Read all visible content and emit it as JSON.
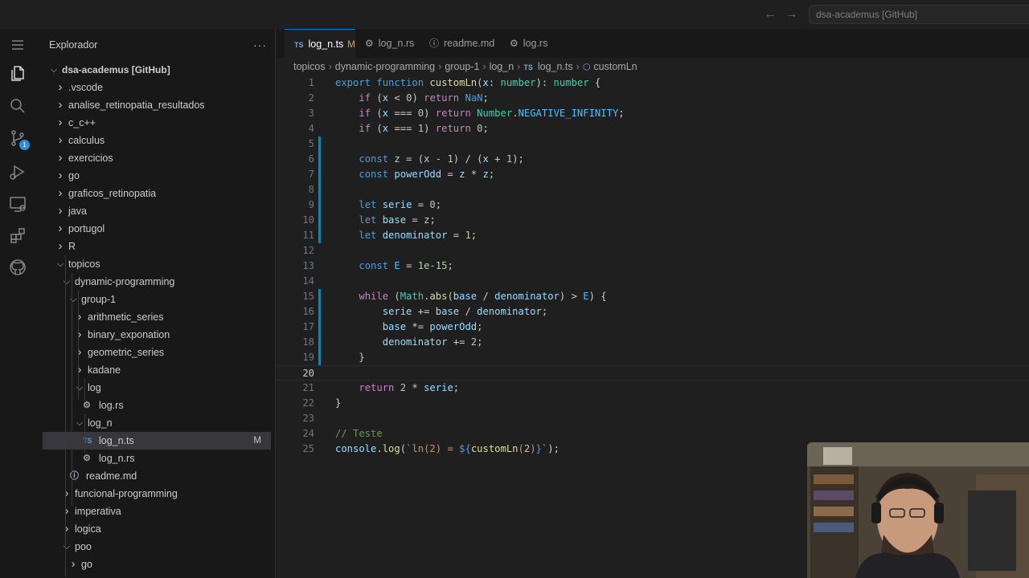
{
  "titlebar": {
    "back_icon": "arrow-left-icon",
    "forward_icon": "arrow-right-icon",
    "command_center": "dsa-academus [GitHub]"
  },
  "activity_bar": {
    "items": [
      "menu-icon",
      "files-icon",
      "search-icon",
      "source-control-icon",
      "run-debug-icon",
      "remote-explorer-icon",
      "extensions-icon",
      "github-icon"
    ],
    "source_control_badge": "1"
  },
  "sidebar": {
    "title": "Explorador",
    "more": "···",
    "root": "dsa-academus [GitHub]",
    "items": [
      {
        "label": ".vscode",
        "kind": "folder",
        "expanded": false
      },
      {
        "label": "analise_retinopatia_resultados",
        "kind": "folder",
        "expanded": false
      },
      {
        "label": "c_c++",
        "kind": "folder",
        "expanded": false
      },
      {
        "label": "calculus",
        "kind": "folder",
        "expanded": false
      },
      {
        "label": "exercicios",
        "kind": "folder",
        "expanded": false
      },
      {
        "label": "go",
        "kind": "folder",
        "expanded": false
      },
      {
        "label": "graficos_retinopatia",
        "kind": "folder",
        "expanded": false
      },
      {
        "label": "java",
        "kind": "folder",
        "expanded": false
      },
      {
        "label": "portugol",
        "kind": "folder",
        "expanded": false
      },
      {
        "label": "R",
        "kind": "folder",
        "expanded": false
      },
      {
        "label": "topicos",
        "kind": "folder",
        "expanded": true
      },
      {
        "label": "dynamic-programming",
        "kind": "folder",
        "expanded": true
      },
      {
        "label": "group-1",
        "kind": "folder",
        "expanded": true
      },
      {
        "label": "arithmetic_series",
        "kind": "folder",
        "expanded": false
      },
      {
        "label": "binary_exponation",
        "kind": "folder",
        "expanded": false
      },
      {
        "label": "geometric_series",
        "kind": "folder",
        "expanded": false
      },
      {
        "label": "kadane",
        "kind": "folder",
        "expanded": false
      },
      {
        "label": "log",
        "kind": "folder",
        "expanded": true
      },
      {
        "label": "log.rs",
        "kind": "rust-file"
      },
      {
        "label": "log_n",
        "kind": "folder",
        "expanded": true
      },
      {
        "label": "log_n.ts",
        "kind": "ts-file",
        "icon_text": "TS",
        "status": "M"
      },
      {
        "label": "log_n.rs",
        "kind": "rust-file"
      },
      {
        "label": "readme.md",
        "kind": "info-file"
      },
      {
        "label": "funcional-programming",
        "kind": "folder",
        "expanded": false
      },
      {
        "label": "imperativa",
        "kind": "folder",
        "expanded": false
      },
      {
        "label": "logica",
        "kind": "folder",
        "expanded": false
      },
      {
        "label": "poo",
        "kind": "folder",
        "expanded": true
      },
      {
        "label": "go",
        "kind": "folder",
        "expanded": false
      }
    ]
  },
  "tabs": [
    {
      "label": "log_n.ts",
      "icon_text": "TS",
      "modified": "M",
      "active": true
    },
    {
      "label": "log_n.rs",
      "icon": "rust-icon"
    },
    {
      "label": "readme.md",
      "icon": "info-icon"
    },
    {
      "label": "log.rs",
      "icon": "rust-icon"
    }
  ],
  "breadcrumb": {
    "parts": [
      "topicos",
      "dynamic-programming",
      "group-1",
      "log_n"
    ],
    "file": "log_n.ts",
    "file_icon_text": "TS",
    "symbol": "customLn"
  },
  "editor": {
    "language": "typescript",
    "current_line": 20,
    "lines": [
      "export function customLn(x: number): number {",
      "    if (x < 0) return NaN;",
      "    if (x === 0) return Number.NEGATIVE_INFINITY;",
      "    if (x === 1) return 0;",
      "",
      "    const z = (x - 1) / (x + 1);",
      "    const powerOdd = z * z;",
      "",
      "    let serie = 0;",
      "    let base = z;",
      "    let denominator = 1;",
      "",
      "    const E = 1e-15;",
      "",
      "    while (Math.abs(base / denominator) > E) {",
      "        serie += base / denominator;",
      "        base *= powerOdd;",
      "        denominator += 2;",
      "    }",
      "",
      "    return 2 * serie;",
      "}",
      "",
      "// Teste",
      "console.log(`ln(2) = ${customLn(2)}`);"
    ]
  },
  "webcam": {
    "content": "webcam-overlay"
  },
  "colors": {
    "keyword": "#569cd6",
    "control": "#c586c0",
    "function": "#dcdcaa",
    "variable": "#9cdcfe",
    "type": "#4ec9b0",
    "number": "#b5cea8",
    "comment": "#6a9955",
    "string": "#ce9178",
    "accent": "#0078d4"
  }
}
